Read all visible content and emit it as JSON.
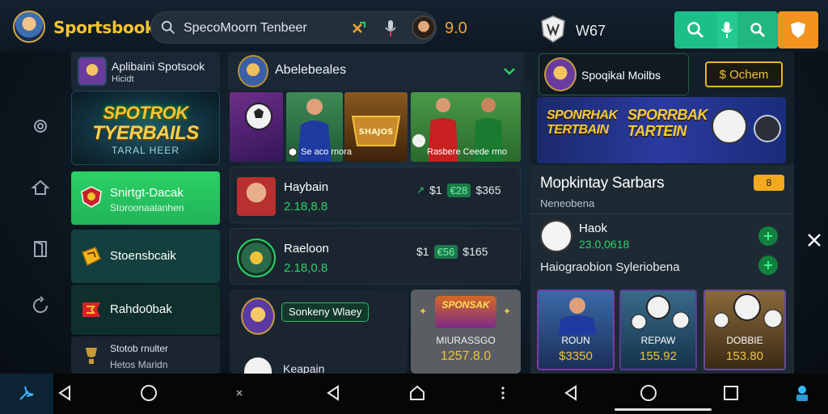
{
  "header": {
    "brand": "Sportsbook",
    "search_value": "SpecoMoorn Tenbeer",
    "rating": "9.0",
    "w_label": "W67"
  },
  "column1": {
    "card_title": "Aplibaini Spotsook",
    "card_sub": "Hicidt",
    "promo_line1": "SPOTROK",
    "promo_line2": "TYERBAILS",
    "promo_line3": "TARAL HEER",
    "nav": [
      {
        "label": "Snirtgt-Dacak",
        "sub": "Storoonaalanhen"
      },
      {
        "label": "Stoensbcaik",
        "sub": ""
      },
      {
        "label": "Rahdo0bak",
        "sub": ""
      },
      {
        "label": "Stotob rnulter",
        "sub": "Hetos Maridn"
      }
    ]
  },
  "column2": {
    "title": "Abelebeales",
    "thumb_caption_left": "Se aco rnora",
    "thumb_caption_right": "Rasbere Ceede rmo",
    "matches": [
      {
        "name": "Haybain",
        "score": "2.18,8.8",
        "odd1": "$1",
        "odd2": "€28",
        "odd3": "$365"
      },
      {
        "name": "Raeloon",
        "score": "2.18,0.8",
        "odd1": "$1",
        "odd2": "€56",
        "odd3": "$165"
      }
    ],
    "featured_chip": "Sonkeny Wlaey",
    "featured_name": "Keapain",
    "prize_logo": "SPONSAK",
    "prize_label": "MIURASSGO",
    "prize_value": "1257.8.0"
  },
  "column3": {
    "pill_label": "Spoqikal Moilbs",
    "pill_button": "$ Ochem",
    "banner_left": "SPONRHAK TERTBAIN",
    "banner_right": "SPORRBAK TARTEIN",
    "section_title": "Mopkintay Sarbars",
    "section_sub": "Neneobena",
    "tag": "8",
    "match_name": "Haok",
    "match_score": "23.0,0618",
    "line": "Haiograobion Syleriobena",
    "cards": [
      {
        "label": "ROUN",
        "value": "$3350"
      },
      {
        "label": "REPAW",
        "value": "155.92"
      },
      {
        "label": "DOBBIE",
        "value": "153.80"
      }
    ]
  },
  "colors": {
    "brand": "#f4c330",
    "accent_green": "#2bd166",
    "accent_orange": "#f1931e",
    "gold": "#f2c13a"
  }
}
